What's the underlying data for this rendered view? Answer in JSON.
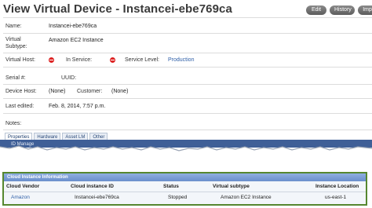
{
  "page": {
    "title": "View Virtual Device - Instancei-ebe769ca"
  },
  "toolbar": {
    "edit_label": "Edit",
    "history_label": "History",
    "import_label": "Impo"
  },
  "fields": {
    "name": {
      "label": "Name:",
      "value": "Instancei-ebe769ca"
    },
    "virtual_subtype": {
      "label_line1": "Virtual",
      "label_line2": "Subtype:",
      "value": "Amazon EC2 Instance"
    },
    "virtual_host": {
      "label": "Virtual Host:"
    },
    "in_service": {
      "label": "In Service:"
    },
    "service_level": {
      "label": "Service Level:",
      "value": "Production"
    },
    "serial": {
      "label": "Serial #:"
    },
    "uuid": {
      "label": "UUID:"
    },
    "device_host": {
      "label": "Device Host:",
      "value": "(None)"
    },
    "customer": {
      "label": "Customer:",
      "value": "(None)"
    },
    "last_edited": {
      "label": "Last edited:",
      "value": "Feb. 8, 2014, 7:57 p.m."
    },
    "notes": {
      "label": "Notes:"
    }
  },
  "tabs": [
    {
      "label": "Properties"
    },
    {
      "label": "Hardware"
    },
    {
      "label": "Asset LM"
    },
    {
      "label": "Other"
    }
  ],
  "torn_text": "ID Manage",
  "cloud_panel": {
    "title": "Cloud Instance Information",
    "columns": [
      "Cloud Vendor",
      "Cloud instance ID",
      "Status",
      "Virtual subtype",
      "Instance Location"
    ],
    "row": [
      "Amazon",
      "Instancei-ebe769ca",
      "Stopped",
      "Amazon EC2 Instance",
      "us-east-1"
    ]
  },
  "colors": {
    "status_red": "#dd2222",
    "panel_border": "#56872f",
    "panel_header": "#7a9bd6",
    "link": "#3060a8"
  }
}
